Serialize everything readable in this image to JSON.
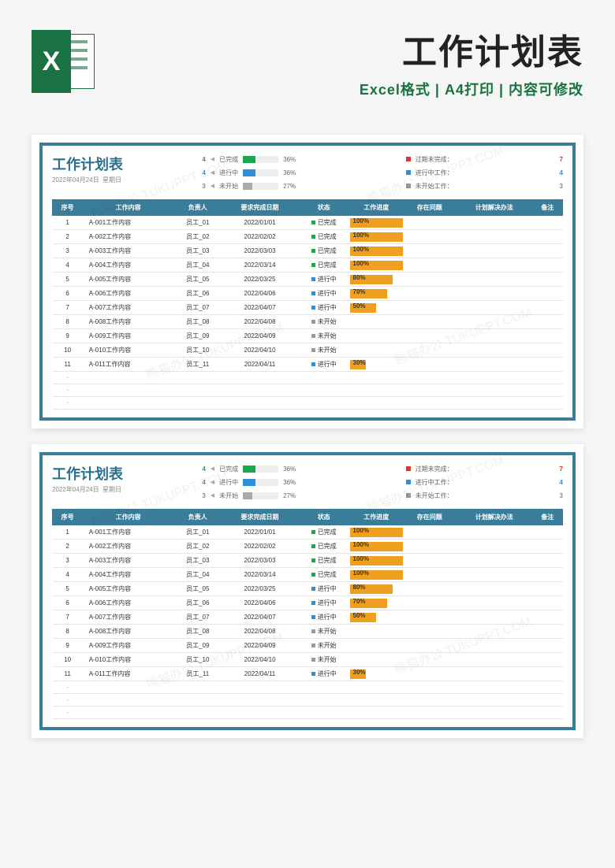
{
  "header": {
    "excel_letter": "X",
    "title": "工作计划表",
    "subtitle": "Excel格式 | A4打印 | 内容可修改"
  },
  "watermark": "熊猫办公 TUKUPPT.COM",
  "sheet": {
    "title": "工作计划表",
    "date": "2022年04月24日",
    "weekday": "星期日",
    "stats_mid": [
      {
        "count": "4",
        "count_class": "n-green",
        "label": "已完成",
        "bar_color": "#1aa84e",
        "bar_w": "36%",
        "pct": "36%"
      },
      {
        "count": "4",
        "count_class": "n-blue",
        "label": "进行中",
        "bar_color": "#2e8fd8",
        "bar_w": "36%",
        "pct": "36%"
      },
      {
        "count": "3",
        "count_class": "n-gray",
        "label": "未开始",
        "bar_color": "#aaa",
        "bar_w": "27%",
        "pct": "27%"
      }
    ],
    "stats_right": [
      {
        "dot": "#d33",
        "label": "过期未完成：",
        "value": "7",
        "vclass": "n-red"
      },
      {
        "dot": "#2e8fd8",
        "label": "进行中工作：",
        "value": "4",
        "vclass": "n-blue"
      },
      {
        "dot": "#999",
        "label": "未开始工作：",
        "value": "3",
        "vclass": "n-gray"
      }
    ],
    "columns": [
      "序号",
      "工作内容",
      "负责人",
      "要求完成日期",
      "状态",
      "工作进度",
      "存在问题",
      "计划解决办法",
      "备注"
    ],
    "rows": [
      {
        "no": "1",
        "content": "A-001工作内容",
        "owner": "员工_01",
        "due": "2022/01/01",
        "status": "已完成",
        "sclass": "sd-g",
        "pct": 100
      },
      {
        "no": "2",
        "content": "A-002工作内容",
        "owner": "员工_02",
        "due": "2022/02/02",
        "status": "已完成",
        "sclass": "sd-g",
        "pct": 100
      },
      {
        "no": "3",
        "content": "A-003工作内容",
        "owner": "员工_03",
        "due": "2022/03/03",
        "status": "已完成",
        "sclass": "sd-g",
        "pct": 100
      },
      {
        "no": "4",
        "content": "A-004工作内容",
        "owner": "员工_04",
        "due": "2022/03/14",
        "status": "已完成",
        "sclass": "sd-g",
        "pct": 100
      },
      {
        "no": "5",
        "content": "A-005工作内容",
        "owner": "员工_05",
        "due": "2022/03/25",
        "status": "进行中",
        "sclass": "sd-b",
        "pct": 80
      },
      {
        "no": "6",
        "content": "A-006工作内容",
        "owner": "员工_06",
        "due": "2022/04/06",
        "status": "进行中",
        "sclass": "sd-b",
        "pct": 70
      },
      {
        "no": "7",
        "content": "A-007工作内容",
        "owner": "员工_07",
        "due": "2022/04/07",
        "status": "进行中",
        "sclass": "sd-b",
        "pct": 50
      },
      {
        "no": "8",
        "content": "A-008工作内容",
        "owner": "员工_08",
        "due": "2022/04/08",
        "status": "未开始",
        "sclass": "sd-y",
        "pct": 0
      },
      {
        "no": "9",
        "content": "A-009工作内容",
        "owner": "员工_09",
        "due": "2022/04/09",
        "status": "未开始",
        "sclass": "sd-y",
        "pct": 0
      },
      {
        "no": "10",
        "content": "A-010工作内容",
        "owner": "员工_10",
        "due": "2022/04/10",
        "status": "未开始",
        "sclass": "sd-y",
        "pct": 0
      },
      {
        "no": "11",
        "content": "A-011工作内容",
        "owner": "员工_11",
        "due": "2022/04/11",
        "status": "进行中",
        "sclass": "sd-b",
        "pct": 30
      }
    ],
    "empty_rows": 3
  }
}
